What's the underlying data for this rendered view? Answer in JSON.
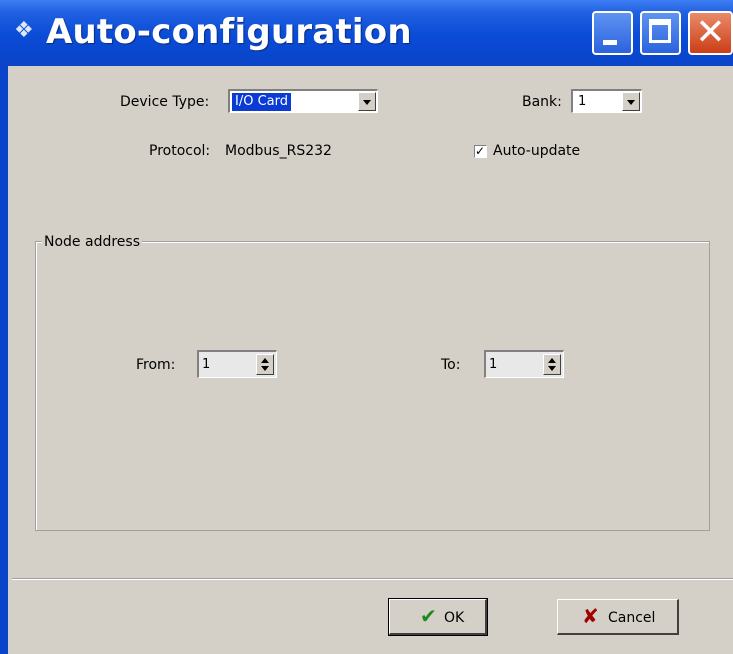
{
  "window": {
    "title": "Auto-configuration",
    "title_bar_color": "#0a4bd6",
    "close_button_color": "#cc3d16"
  },
  "form": {
    "device_type_label": "Device Type:",
    "device_type_value": "I/O Card",
    "bank_label": "Bank:",
    "bank_value": "1",
    "protocol_label": "Protocol:",
    "protocol_value": "Modbus_RS232",
    "auto_update_label": "Auto-update",
    "auto_update_checked": true
  },
  "node_address": {
    "legend": "Node address",
    "from_label": "From:",
    "from_value": "1",
    "to_label": "To:",
    "to_value": "1"
  },
  "buttons": {
    "ok_label": "OK",
    "ok_icon": "checkmark-icon",
    "cancel_label": "Cancel",
    "cancel_icon": "cross-icon"
  }
}
